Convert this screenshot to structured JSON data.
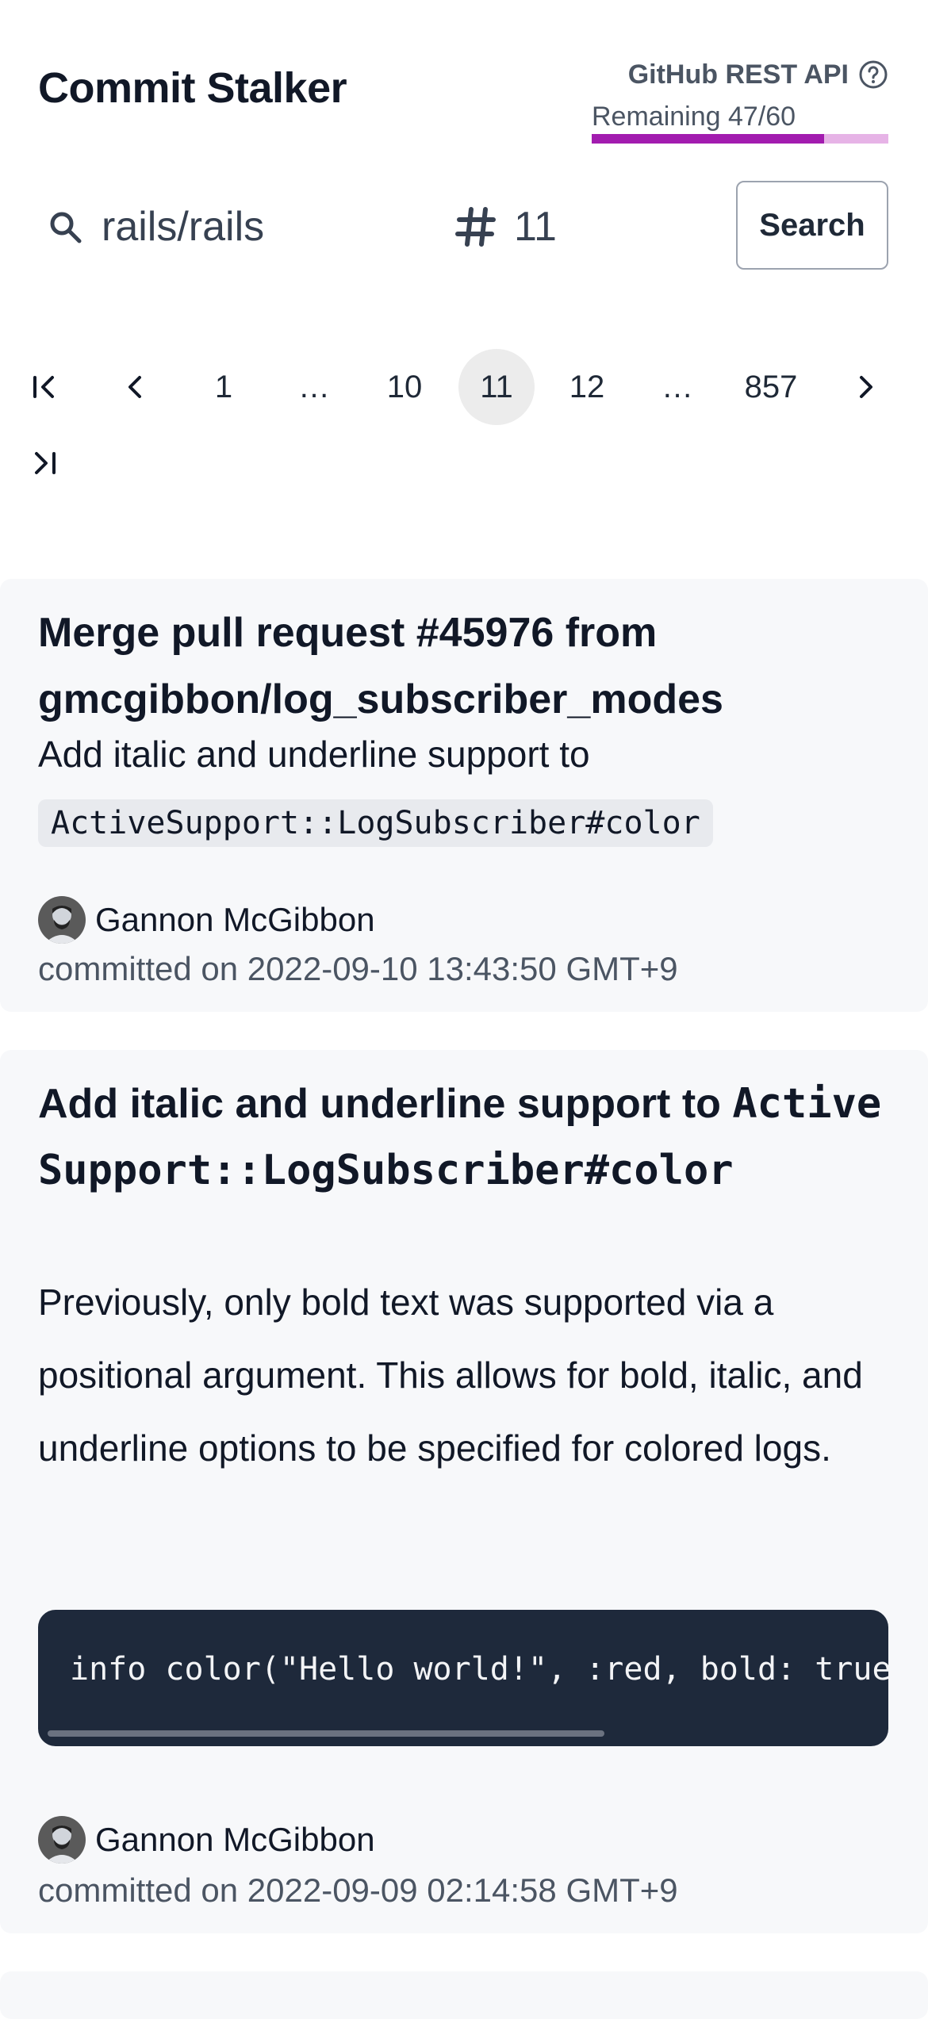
{
  "header": {
    "app_title": "Commit Stalker",
    "api_title": "GitHub REST API",
    "api_remaining_label": "Remaining 47/60",
    "api_remaining_fraction": 0.783,
    "accent_color": "#a21caf",
    "help_icon": "question-circle-icon"
  },
  "search": {
    "repo_value": "rails/rails",
    "page_value": "11",
    "button_label": "Search",
    "search_icon": "search-icon",
    "hash_icon": "hash-icon"
  },
  "pager": {
    "items": [
      "1",
      "…",
      "10",
      "11",
      "12",
      "…",
      "857"
    ],
    "active": "11",
    "first_icon": "first-page-icon",
    "prev_icon": "chevron-left-icon",
    "next_icon": "chevron-right-icon",
    "last_icon": "last-page-icon"
  },
  "commits": [
    {
      "title": "Merge pull request #45976 from gmcgibbon/log_subscriber_modes",
      "body_text": "Add italic and underline support to",
      "body_code": "ActiveSupport::LogSubscriber#color",
      "author": "Gannon McGibbon",
      "committed": "committed on 2022-09-10 13:43:50 GMT+9"
    },
    {
      "title_text": "Add italic and underline support to",
      "title_code": "ActiveSupport::LogSubscriber#color",
      "body": "Previously, only bold text was supported via a positional argument. This allows for bold, italic, and underline options to be specified for colored logs.",
      "code_block": "info color(\"Hello world!\", :red, bold: true, underline: true)",
      "author": "Gannon McGibbon",
      "committed": "committed on 2022-09-09 02:14:58 GMT+9"
    }
  ]
}
